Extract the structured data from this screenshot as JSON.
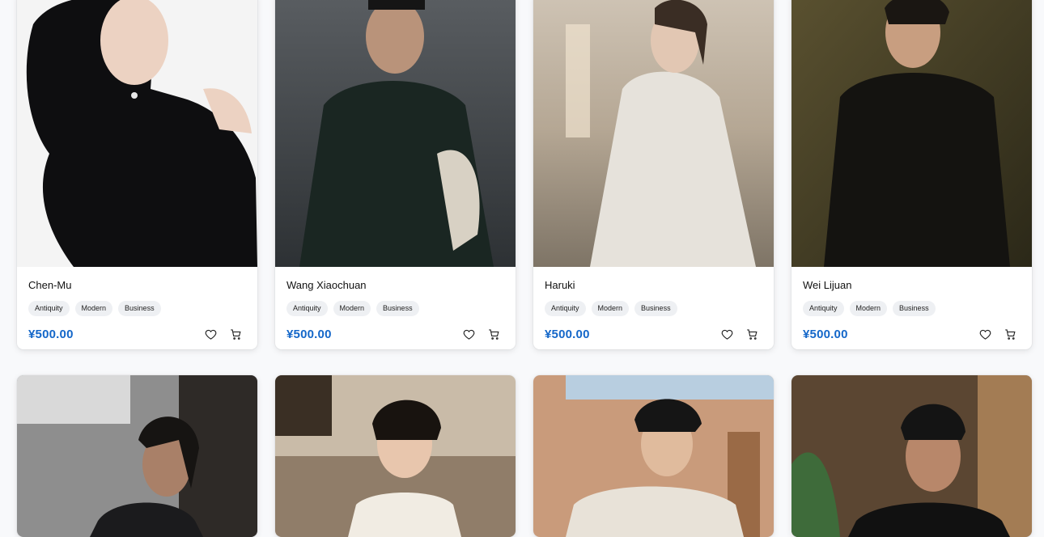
{
  "products": [
    {
      "name": "Chen-Mu",
      "tags": [
        "Antiquity",
        "Modern",
        "Business"
      ],
      "price": "¥500.00"
    },
    {
      "name": "Wang Xiaochuan",
      "tags": [
        "Antiquity",
        "Modern",
        "Business"
      ],
      "price": "¥500.00"
    },
    {
      "name": "Haruki",
      "tags": [
        "Antiquity",
        "Modern",
        "Business"
      ],
      "price": "¥500.00"
    },
    {
      "name": "Wei Lijuan",
      "tags": [
        "Antiquity",
        "Modern",
        "Business"
      ],
      "price": "¥500.00"
    }
  ],
  "icons": {
    "favorite": "heart-icon",
    "cart": "cart-icon"
  },
  "colors": {
    "price": "#1467c9",
    "tag_bg": "#eef0f3",
    "page_bg": "#f8f9fb"
  }
}
